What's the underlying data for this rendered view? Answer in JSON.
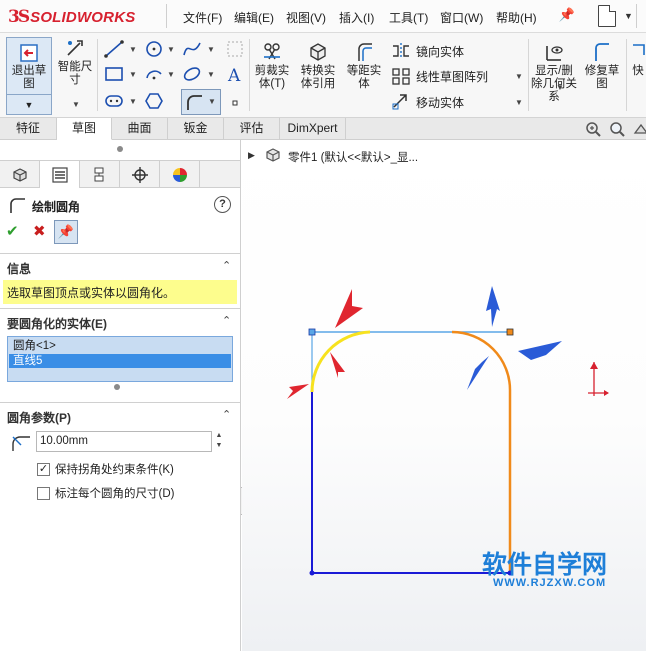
{
  "app": {
    "logo_mark": "3S",
    "logo_text": "SOLIDWORKS"
  },
  "menu": {
    "items": [
      "文件(F)",
      "编辑(E)",
      "视图(V)",
      "插入(I)",
      "工具(T)",
      "窗口(W)",
      "帮助(H)"
    ]
  },
  "ribbon": {
    "exit_sketch": "退出草图",
    "smart_dim": "智能尺寸",
    "trim": "剪裁实体(T)",
    "convert": "转换实体引用",
    "offset": "等距实体",
    "mirror": "镜向实体",
    "linear_pattern": "线性草图阵列",
    "move": "移动实体",
    "show_relations": "显示/删除几何关系",
    "repair": "修复草图",
    "quick": "快"
  },
  "tabs": [
    "特征",
    "草图",
    "曲面",
    "钣金",
    "评估",
    "DimXpert"
  ],
  "active_tab": "草图",
  "panel": {
    "title": "绘制圆角",
    "help": "?",
    "info_header": "信息",
    "info_text": "选取草图顶点或实体以圆角化。",
    "entities_header": "要圆角化的实体(E)",
    "entities": [
      "圆角<1>",
      "直线5"
    ],
    "params_header": "圆角参数(P)",
    "radius": "10.00mm",
    "keep_constraints": "保持拐角处约束条件(K)",
    "keep_constraints_checked": true,
    "dimension_each": "标注每个圆角的尺寸(D)",
    "dimension_each_checked": false
  },
  "tree": {
    "part_label": "零件1 (默认<<默认>_显..."
  },
  "watermark": {
    "cn": "软件自学网",
    "en": "WWW.RJZXW.COM"
  },
  "colors": {
    "sketch_line": "#1a1ad6",
    "fillet_selected": "#f7e21e",
    "fillet_highlight": "#f08a1a",
    "top_line": "#5aa6e6",
    "arrow_red": "#e0262f",
    "arrow_blue": "#2a5bd7",
    "accent": "#d7212f"
  }
}
